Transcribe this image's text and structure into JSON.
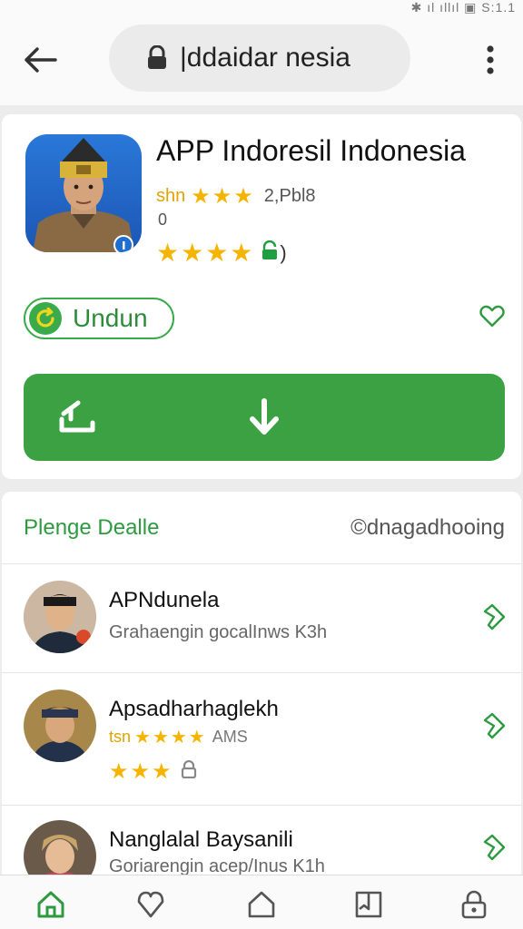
{
  "status_bar": {
    "text": "✱ ıl ıllıl ▣ S:1.1"
  },
  "browser": {
    "url": "|ddaidar nesia",
    "icons": {
      "back": "arrow-left-icon",
      "lock": "lock-icon",
      "menu": "more-vertical-icon"
    }
  },
  "app": {
    "title": "APP Indoresil Indonesia",
    "rating_label": "shn",
    "stars": "★★★",
    "rating_count": "2,Pbl8",
    "small_number": "0",
    "stars_row2": "★★★★",
    "chip_label": "Undun",
    "install_icons": {
      "left": "share-icon",
      "center": "download-arrow-icon"
    }
  },
  "section": {
    "title": "Plenge Dealle",
    "link": "©dnagadhooing"
  },
  "list_items": [
    {
      "name": "APNdunela",
      "subtitle": "Grahaengin gocalInws K3h"
    },
    {
      "name": "Apsadharhaglekh",
      "rating_label": "tsn",
      "stars": "★★★★",
      "count": "AMS",
      "stars2": "★★★"
    },
    {
      "name": "Nanglalal Baysanili",
      "subtitle": "Goriarengin acep/Inus K1h"
    }
  ],
  "bottom_nav": [
    "home-icon",
    "heart-icon",
    "house-outline-icon",
    "book-icon",
    "lock-icon"
  ],
  "colors": {
    "accent_green": "#3ba142",
    "star_gold": "#f4b400",
    "url_pill": "#ebebeb"
  }
}
